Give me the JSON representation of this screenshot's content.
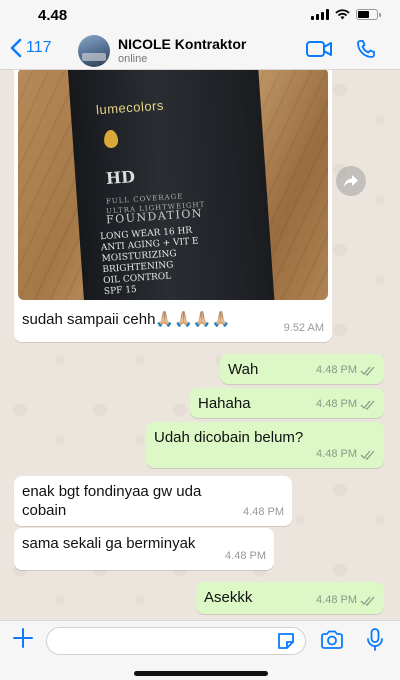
{
  "status_bar": {
    "time": "4.48"
  },
  "header": {
    "back_count": "117",
    "contact_name": "NICOLE Kontraktor",
    "contact_status": "online"
  },
  "messages": [
    {
      "direction": "in",
      "type": "image",
      "caption": "sudah sampaii cehh🙏🏼🙏🏼🙏🏼🙏🏼",
      "time": "9.52 AM"
    },
    {
      "direction": "out",
      "text": "Wah",
      "time": "4.48 PM"
    },
    {
      "direction": "out",
      "text": "Hahaha",
      "time": "4.48 PM"
    },
    {
      "direction": "out",
      "text": "Udah dicobain belum?",
      "time": "4.48 PM"
    },
    {
      "direction": "in",
      "text_line1": "enak bgt fondinyaa gw uda",
      "text_line2": "cobain",
      "time": "4.48 PM"
    },
    {
      "direction": "in",
      "text": "sama sekali ga berminyak",
      "time": "4.48 PM"
    },
    {
      "direction": "out",
      "text": "Asekkk",
      "time": "4.48 PM"
    }
  ],
  "product_photo": {
    "brand": "lumecolors",
    "hd": "HD",
    "line1": "FULL COVERAGE",
    "line2": "ULTRA LIGHTWEIGHT",
    "line3": "FOUNDATION",
    "features": [
      "LONG WEAR 16 HR",
      "ANTI AGING + VIT E",
      "MOISTURIZING",
      "BRIGHTENING",
      "OIL CONTROL",
      "SPF 15"
    ]
  },
  "input": {
    "placeholder": "",
    "value": ""
  },
  "icons": {
    "back": "chevron-left-icon",
    "video": "video-call-icon",
    "phone": "phone-call-icon",
    "forward": "forward-icon",
    "plus": "plus-icon",
    "sticker": "sticker-icon",
    "camera": "camera-icon",
    "mic": "microphone-icon"
  },
  "colors": {
    "accent": "#0a7aff",
    "outgoing_bubble": "#dcf8c6",
    "incoming_bubble": "#ffffff",
    "chat_bg": "#ece5dd"
  }
}
